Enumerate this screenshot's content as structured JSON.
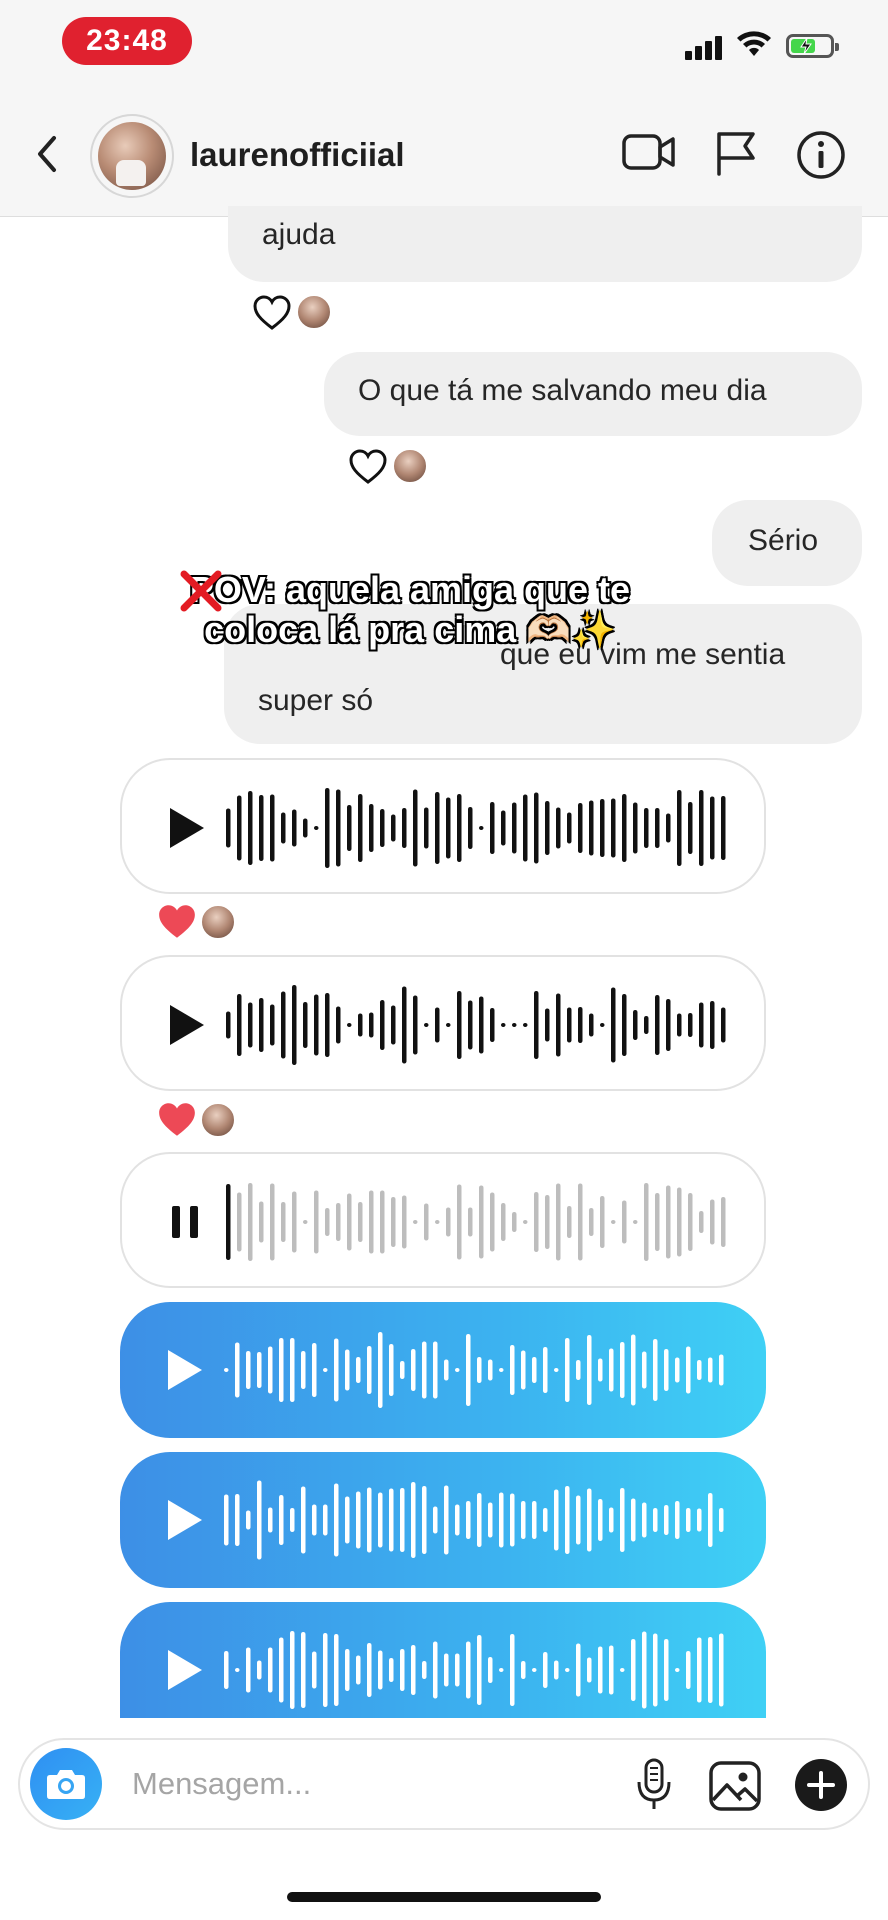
{
  "status_bar": {
    "time": "23:48"
  },
  "header": {
    "username": "laurenofficiial"
  },
  "messages": {
    "m1": "ajuda",
    "m2": "O que tá me salvando meu dia",
    "m3": "Sério",
    "m4_line1": "que eu vim me sentia",
    "m4_line2": "super só"
  },
  "voice_messages": [
    {
      "style": "received",
      "state": "play",
      "reaction": "heart-red"
    },
    {
      "style": "received",
      "state": "play",
      "reaction": "heart-red"
    },
    {
      "style": "received",
      "state": "pause"
    },
    {
      "style": "sent",
      "state": "play"
    },
    {
      "style": "sent",
      "state": "play"
    },
    {
      "style": "sent",
      "state": "play"
    }
  ],
  "overlay_caption": {
    "line1": "POV: aquela amiga que te",
    "line2": "coloca lá pra cima 🫶🏻✨"
  },
  "composer": {
    "placeholder": "Mensagem..."
  },
  "colors": {
    "accent_blue": "#3b9ff0",
    "heart_red": "#ed4956",
    "status_red": "#e0212f"
  }
}
